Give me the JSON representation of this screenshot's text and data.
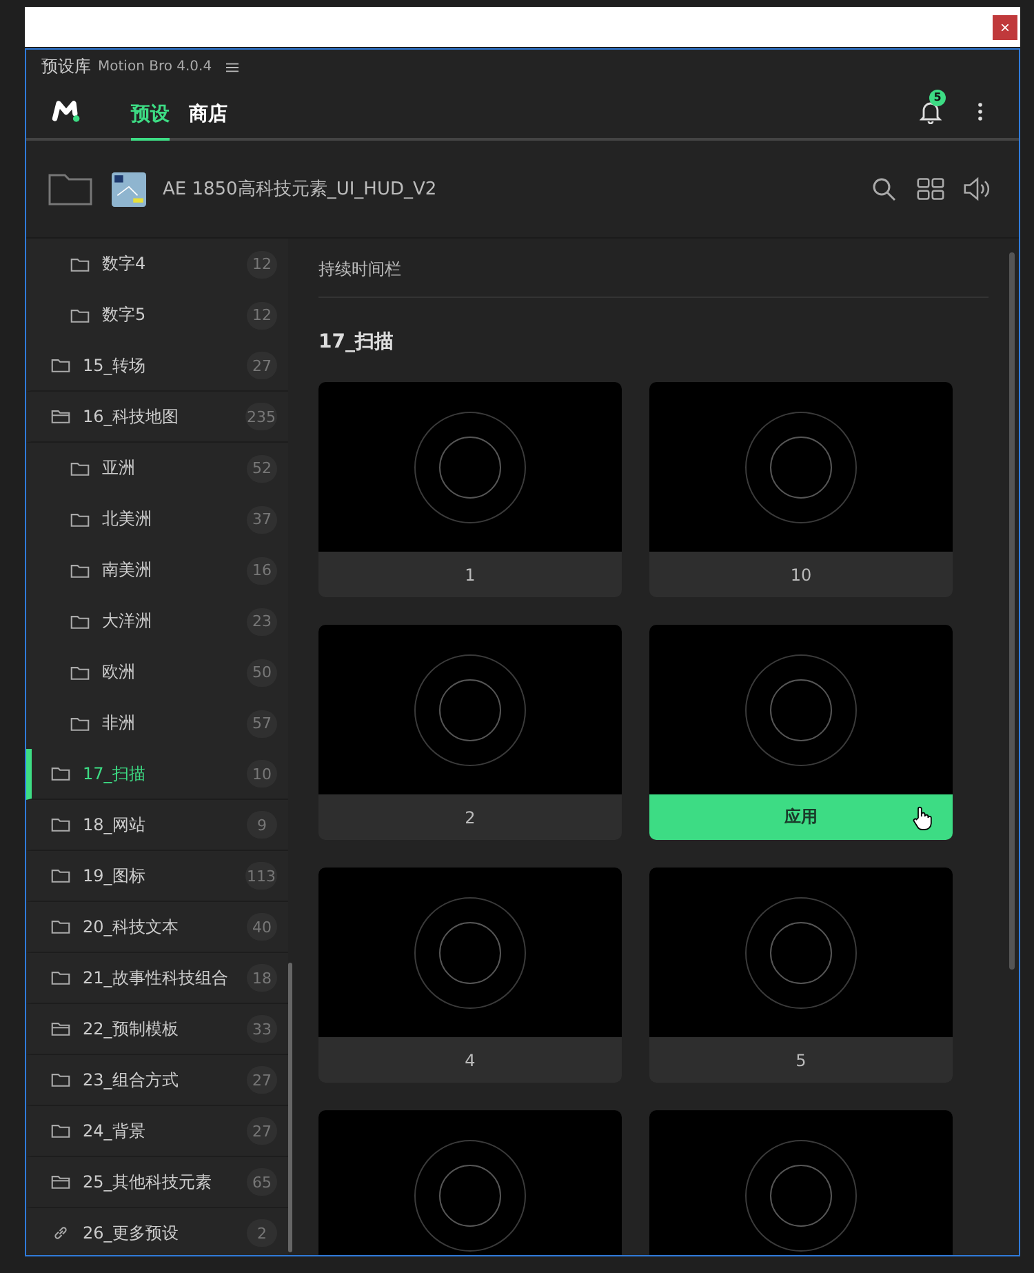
{
  "window": {
    "close_button": "×"
  },
  "panel": {
    "title": "预设库",
    "version": "Motion Bro 4.0.4"
  },
  "nav": {
    "tabs": [
      {
        "label": "预设",
        "selected": true
      },
      {
        "label": "商店",
        "selected": false
      }
    ],
    "notification_count": "5"
  },
  "pack": {
    "name": "AE 1850高科技元素_UI_HUD_V2"
  },
  "sidebar": {
    "continued_children": [
      {
        "label": "数字4",
        "count": "12",
        "kind": "folder"
      },
      {
        "label": "数字5",
        "count": "12",
        "kind": "folder"
      }
    ],
    "items": [
      {
        "label": "15_转场",
        "count": "27",
        "kind": "folder",
        "selected": false
      },
      {
        "label": "16_科技地图",
        "count": "235",
        "kind": "open-folder",
        "selected": false,
        "children": [
          {
            "label": "亚洲",
            "count": "52",
            "kind": "folder"
          },
          {
            "label": "北美洲",
            "count": "37",
            "kind": "folder"
          },
          {
            "label": "南美洲",
            "count": "16",
            "kind": "folder"
          },
          {
            "label": "大洋洲",
            "count": "23",
            "kind": "folder"
          },
          {
            "label": "欧洲",
            "count": "50",
            "kind": "folder"
          },
          {
            "label": "非洲",
            "count": "57",
            "kind": "folder"
          }
        ]
      },
      {
        "label": "17_扫描",
        "count": "10",
        "kind": "folder",
        "selected": true
      },
      {
        "label": "18_网站",
        "count": "9",
        "kind": "folder",
        "selected": false
      },
      {
        "label": "19_图标",
        "count": "113",
        "kind": "folder",
        "selected": false
      },
      {
        "label": "20_科技文本",
        "count": "40",
        "kind": "folder",
        "selected": false
      },
      {
        "label": "21_故事性科技组合",
        "count": "18",
        "kind": "folder",
        "selected": false
      },
      {
        "label": "22_预制模板",
        "count": "33",
        "kind": "open-folder",
        "selected": false
      },
      {
        "label": "23_组合方式",
        "count": "27",
        "kind": "folder",
        "selected": false
      },
      {
        "label": "24_背景",
        "count": "27",
        "kind": "folder",
        "selected": false
      },
      {
        "label": "25_其他科技元素",
        "count": "65",
        "kind": "open-folder",
        "selected": false
      },
      {
        "label": "26_更多预设",
        "count": "2",
        "kind": "link",
        "selected": false
      }
    ]
  },
  "content": {
    "breadcrumb": "持续时间栏",
    "section_title": "17_扫描",
    "cards": [
      {
        "label": "1",
        "kind": "preset"
      },
      {
        "label": "10",
        "kind": "preset"
      },
      {
        "label": "2",
        "kind": "preset"
      },
      {
        "label": "应用",
        "kind": "apply"
      },
      {
        "label": "4",
        "kind": "preset"
      },
      {
        "label": "5",
        "kind": "preset"
      },
      {
        "kind": "cut-off"
      },
      {
        "kind": "cut-off"
      }
    ]
  }
}
